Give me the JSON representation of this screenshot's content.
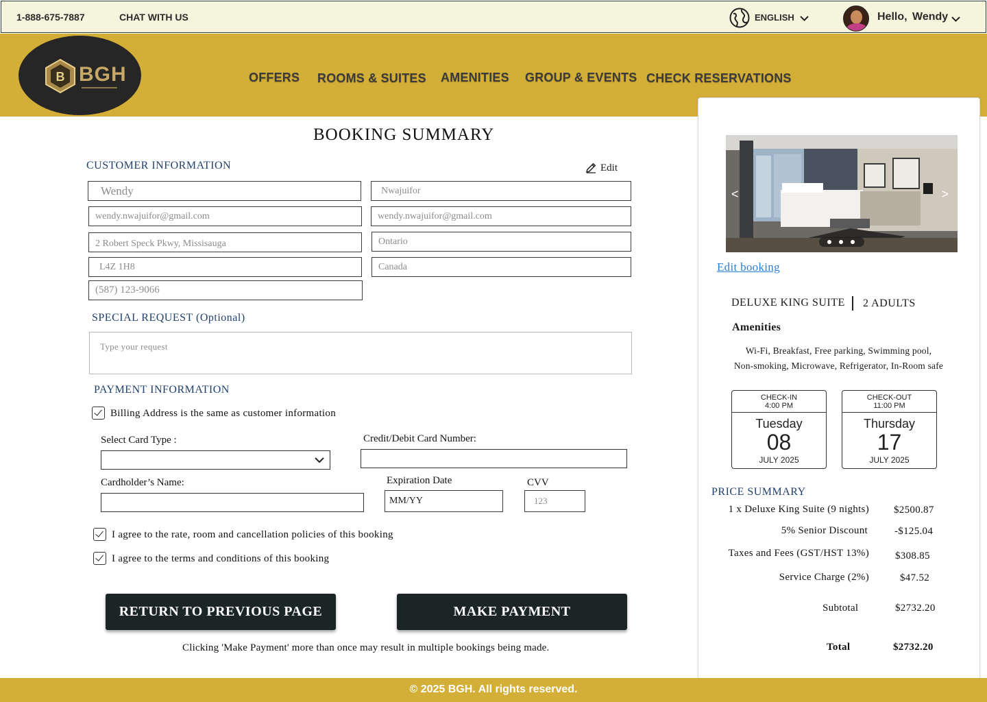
{
  "topbar": {
    "phone": "1-888-675-7887",
    "chat": "CHAT WITH US",
    "language": "ENGLISH",
    "greeting": "Hello,",
    "user_name": "Wendy"
  },
  "brand": {
    "logo_text": "BGH"
  },
  "nav": {
    "items": [
      "OFFERS",
      "ROOMS & SUITES",
      "AMENITIES",
      "GROUP & EVENTS",
      "CHECK RESERVATIONS"
    ]
  },
  "form": {
    "title": "BOOKING SUMMARY",
    "customer_section": "CUSTOMER INFORMATION",
    "edit_label": "Edit",
    "first_name": "Wendy",
    "last_name": "Nwajuifor",
    "email": "wendy.nwajuifor@gmail.com",
    "email_confirm": "wendy.nwajuifor@gmail.com",
    "address": "2 Robert Speck Pkwy, Missisauga",
    "province": "Ontario",
    "postal": "L4Z 1H8",
    "country": "Canada",
    "phone": "(587) 123-9066",
    "special_section": "SPECIAL REQUEST (Optional)",
    "special_placeholder": "Type your request",
    "payment_section": "PAYMENT INFORMATION",
    "billing_same": "Billing Address is the same as customer information",
    "card_type_label": "Select Card Type :",
    "card_number_label": "Credit/Debit Card Number:",
    "cardholder_label": "Cardholder’s Name:",
    "expiry_label": "Expiration Date",
    "expiry_placeholder": "MM/YY",
    "cvv_label": "CVV",
    "cvv_placeholder": "123",
    "agree_policies": "I agree to the rate, room and cancellation policies of this booking",
    "agree_terms": "I agree to the terms and conditions of this booking",
    "return_button": "RETURN TO PREVIOUS PAGE",
    "pay_button": "MAKE PAYMENT",
    "warning": "Clicking 'Make Payment' more than once may result in multiple bookings being made."
  },
  "summary": {
    "prev_arrow": "<",
    "next_arrow": ">",
    "edit_booking": "Edit booking",
    "room": "DELUXE KING SUITE",
    "guests": "2 ADULTS",
    "amenities_title": "Amenities",
    "amenities_line1": "Wi-Fi, Breakfast, Free parking, Swimming pool,",
    "amenities_line2": "Non-smoking, Microwave, Refrigerator, In-Room safe",
    "checkin": {
      "label": "CHECK-IN",
      "time": "4:00 PM",
      "day": "Tuesday",
      "date": "08",
      "month": "JULY 2025"
    },
    "checkout": {
      "label": "CHECK-OUT",
      "time": "11:00 PM",
      "day": "Thursday",
      "date": "17",
      "month": "JULY 2025"
    },
    "price_title": "PRICE SUMMARY",
    "lines": [
      {
        "label": "1 x Deluxe King Suite (9 nights)",
        "amount": "$2500.87"
      },
      {
        "label": "5% Senior Discount",
        "amount": "-$125.04"
      },
      {
        "label": "Taxes  and Fees (GST/HST 13%)",
        "amount": "$308.85"
      },
      {
        "label": "Service Charge (2%)",
        "amount": "$47.52"
      }
    ],
    "subtotal_label": "Subtotal",
    "subtotal": "$2732.20",
    "total_label": "Total",
    "total": "$2732.20"
  },
  "footer": {
    "text": "© 2025 BGH. All rights reserved."
  },
  "colors": {
    "gold": "#d4af37",
    "dark": "#1b2526",
    "cream": "#f5f4dc",
    "navy": "#21406b",
    "link": "#2a7fd4"
  },
  "icons": [
    "globe-icon",
    "chevron-down-icon",
    "avatar",
    "pencil-icon",
    "checkbox-checked-icon",
    "chevron-left-icon",
    "chevron-right-icon"
  ]
}
